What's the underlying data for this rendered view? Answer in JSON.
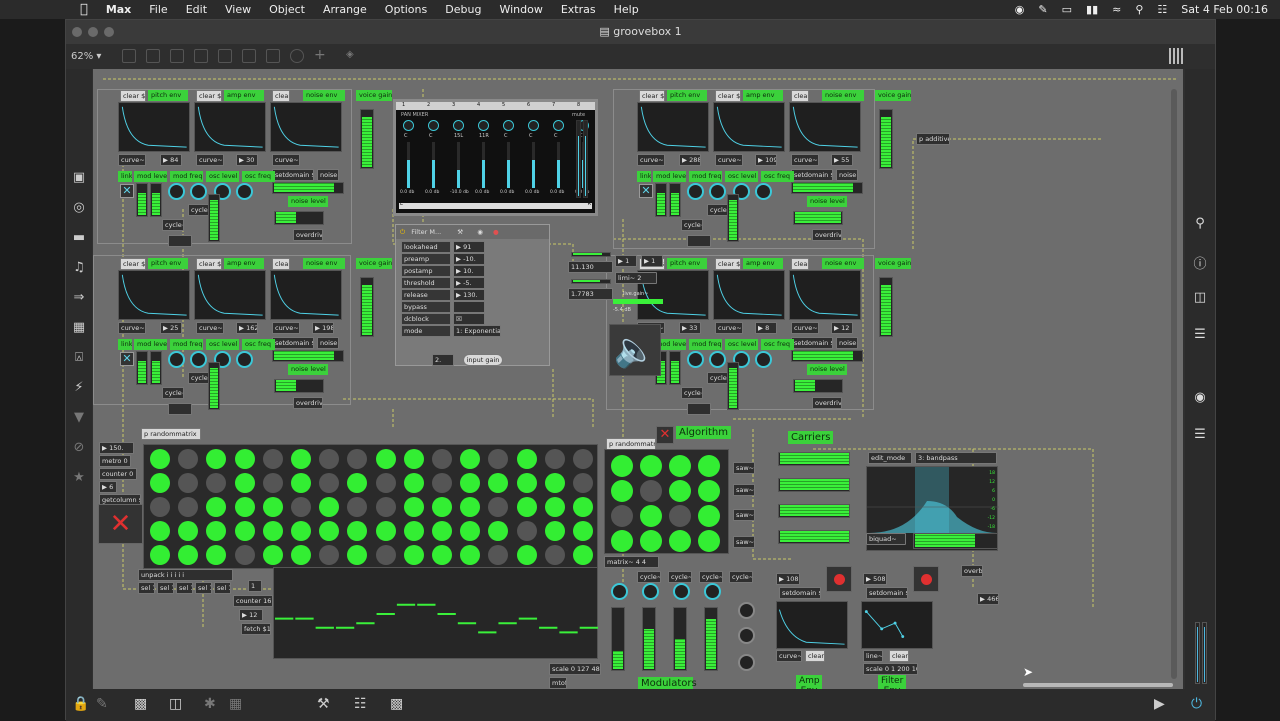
{
  "menubar": {
    "app": "Max",
    "items": [
      "File",
      "Edit",
      "View",
      "Object",
      "Arrange",
      "Options",
      "Debug",
      "Window",
      "Extras",
      "Help"
    ],
    "clock": "Sat 4 Feb  00:16"
  },
  "window": {
    "title": "groovebox 1",
    "zoom": "62%"
  },
  "voices": [
    {
      "clear": "clear $1",
      "pitch": "pitch env",
      "amp_clear": "clear $1",
      "amp": "amp env",
      "noise_clear": "clear",
      "noise": "noise env",
      "gain": "voice gain",
      "v1": "84",
      "v2": "30",
      "curve": "curve~",
      "setdomain": "setdomain $1",
      "noise_lbl": "noise~",
      "noise_level": "noise level",
      "overdrive": "overdrive~",
      "tabs": [
        "link",
        "mod level",
        "mod freq",
        "osc level",
        "osc freq"
      ],
      "cycle": "cycle~"
    },
    {
      "clear": "clear $1",
      "pitch": "pitch env",
      "amp_clear": "clear $1",
      "amp": "amp env",
      "noise_clear": "clear",
      "noise": "noise env",
      "gain": "voice gain",
      "v1": "288",
      "v2": "109",
      "v3": "55",
      "curve": "curve~",
      "setdomain": "setdomain $1",
      "noise_lbl": "noise~",
      "noise_level": "noise level",
      "overdrive": "overdrive~",
      "tabs": [
        "link",
        "mod level",
        "mod freq",
        "osc level",
        "osc freq"
      ],
      "cycle": "cycle~"
    },
    {
      "clear": "clear $1",
      "pitch": "pitch env",
      "amp_clear": "clear $1",
      "amp": "amp env",
      "noise_clear": "clear",
      "noise": "noise env",
      "gain": "voice gain",
      "v1": "25",
      "v2": "162",
      "v3": "198",
      "curve": "curve~",
      "setdomain": "setdomain $1",
      "noise_lbl": "noise~",
      "noise_level": "noise level",
      "overdrive": "overdrive~",
      "tabs": [
        "link",
        "mod level",
        "mod freq",
        "osc level",
        "osc freq"
      ],
      "cycle": "cycle~"
    },
    {
      "clear": "clear $1",
      "pitch": "pitch env",
      "amp_clear": "clear $1",
      "amp": "amp env",
      "noise_clear": "clear",
      "noise": "noise env",
      "gain": "voice gain",
      "v1": "33",
      "v2": "8",
      "v3": "12",
      "curve": "curve~",
      "setdomain": "setdomain $1",
      "noise_lbl": "noise~",
      "noise_level": "noise level",
      "overdrive": "overdrive~",
      "tabs": [
        "link",
        "mod level",
        "mod freq",
        "osc level",
        "osc freq"
      ],
      "cycle": "cycle~"
    }
  ],
  "panmixer": {
    "title": "PAN MIXER",
    "channels": [
      "1",
      "2",
      "3",
      "4",
      "5",
      "6",
      "7",
      "8"
    ],
    "knob_vals": [
      "C",
      "C",
      "15L",
      "11R",
      "C",
      "C",
      "C",
      "C"
    ],
    "db": [
      "0.0 db",
      "0.0 db",
      "-10.0 db",
      "0.0 db",
      "0.0 db",
      "0.0 db",
      "0.0 db",
      "0.0 db"
    ],
    "mute": "mute",
    "L": "L",
    "R": "R"
  },
  "filter": {
    "title": "Filter M...",
    "params": [
      {
        "name": "lookahead",
        "value": "91"
      },
      {
        "name": "preamp",
        "value": "-10."
      },
      {
        "name": "postamp",
        "value": "10."
      },
      {
        "name": "threshold",
        "value": "-5."
      },
      {
        "name": "release",
        "value": "130."
      },
      {
        "name": "bypass",
        "value": ""
      },
      {
        "name": "dcblock",
        "value": "☒"
      },
      {
        "name": "mode",
        "value": "1: Exponential"
      }
    ],
    "num": "2.",
    "input_gain": "input gain",
    "val1": "11.130",
    "val2": "1.7783",
    "lim": "limi~ 2",
    "live_gain": "live.gain~",
    "db": "-5.4 dB"
  },
  "sequencer": {
    "p_randommatrix": "p randommatrix",
    "metro": "metro  0",
    "counter": "counter 0 15",
    "num150": "150.",
    "num6": "6",
    "getcolumn": "getcolumn $1",
    "unpack": "unpack i i i i i",
    "sel": [
      "sel 1",
      "sel 1",
      "sel 1",
      "sel 1",
      "sel 1"
    ],
    "counter16": "counter 16 1",
    "num12": "12",
    "fetch": "fetch $1",
    "scale": "scale 0 127 48 72",
    "mtof": "mtof",
    "one": "1",
    "grid": [
      [
        1,
        0,
        1,
        1,
        0,
        1,
        0,
        0,
        1,
        1,
        0,
        1,
        0,
        1,
        0,
        0
      ],
      [
        1,
        0,
        0,
        1,
        0,
        1,
        0,
        1,
        0,
        1,
        0,
        1,
        1,
        1,
        1,
        0
      ],
      [
        0,
        0,
        1,
        1,
        1,
        0,
        1,
        0,
        0,
        1,
        1,
        1,
        0,
        1,
        1,
        1
      ],
      [
        1,
        1,
        1,
        1,
        1,
        1,
        1,
        1,
        1,
        1,
        1,
        1,
        1,
        0,
        1,
        1
      ],
      [
        1,
        1,
        1,
        0,
        1,
        1,
        0,
        1,
        0,
        1,
        1,
        1,
        0,
        1,
        0,
        1
      ]
    ],
    "pitch_steps": [
      0.45,
      0.45,
      0.35,
      0.35,
      0.4,
      0.5,
      0.6,
      0.6,
      0.5,
      0.4,
      0.3,
      0.4,
      0.45,
      0.35,
      0.3,
      0.35
    ]
  },
  "fm": {
    "p_randommatrix": "p randommatrix",
    "algorithm": "Algorithm",
    "matrix": "matrix~ 4 4",
    "grid": [
      [
        1,
        1,
        1,
        1
      ],
      [
        1,
        0,
        1,
        1
      ],
      [
        0,
        1,
        0,
        1
      ],
      [
        1,
        1,
        1,
        1
      ]
    ],
    "carriers": "Carriers",
    "modulators": "Modulators",
    "cycle": [
      "cycle~",
      "cycle~",
      "cycle~",
      "cycle~"
    ],
    "saw": [
      "saw~",
      "saw~",
      "saw~",
      "saw~"
    ]
  },
  "filterenv": {
    "edit_mode": "edit_mode",
    "mode_val": "3: bandpass",
    "biquad": "biquad~",
    "db_ticks": [
      "18",
      "12",
      "6",
      "0",
      "-6",
      "-12",
      "-18"
    ],
    "v108": "108",
    "setdomain1": "setdomain $1",
    "v508": "508",
    "setdomain2": "setdomain $1",
    "curve": "curve~",
    "clear": "clear",
    "line": "line~",
    "clear2": "clear",
    "scale": "scale 0 1 200 1000",
    "amp_env": "Amp\nEnv",
    "filter_env": "Filter\nEnv",
    "overb": "overb~",
    "v466": "466.",
    "p_additive": "p additive"
  }
}
